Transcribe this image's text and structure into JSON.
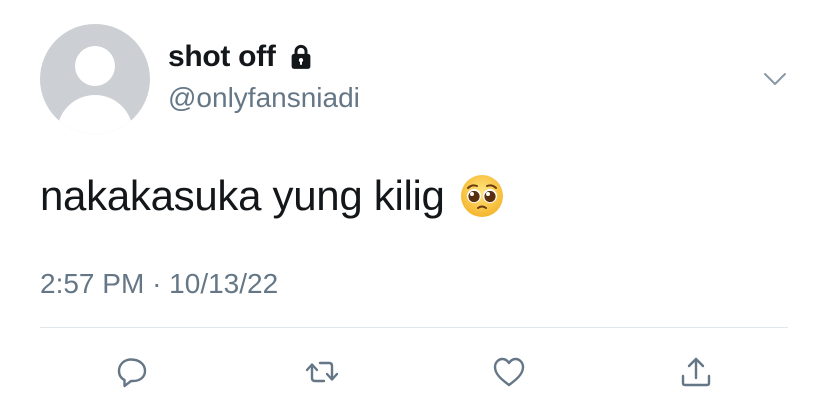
{
  "author": {
    "display_name": "shot off",
    "handle": "@onlyfansniadi",
    "protected_icon": "lock-icon"
  },
  "tweet": {
    "text": "nakakasuka yung kilig",
    "emoji": "pleading-face-icon",
    "time": "2:57 PM",
    "separator": "·",
    "date": "10/13/22"
  },
  "actions": [
    "reply-icon",
    "retweet-icon",
    "like-icon",
    "share-icon"
  ],
  "colors": {
    "text": "#14171a",
    "secondary": "#657786",
    "avatar_bg": "#cccfd3",
    "divider": "#e1e8ed",
    "icon": "#657786"
  }
}
